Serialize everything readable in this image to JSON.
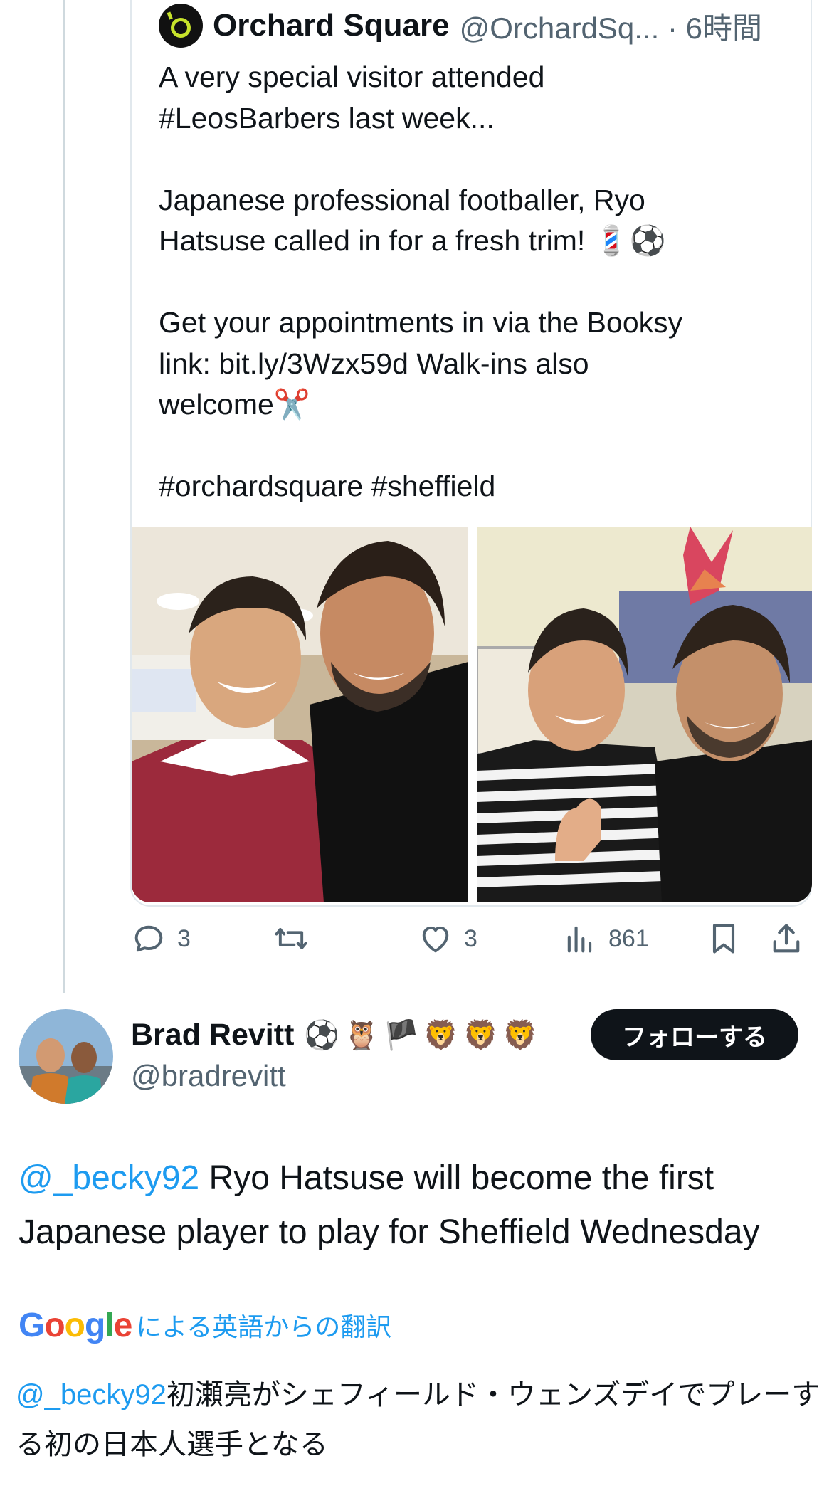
{
  "quote": {
    "name": "Orchard Square",
    "handle_time": "@OrchardSq... · 6時間",
    "text": "A very special visitor attended\n#LeosBarbers last week...\n\nJapanese professional footballer, Ryo\nHatsuse called in for a fresh trim! 💈⚽\n\nGet your appointments in via the Booksy\nlink: bit.ly/3Wzx59d Walk-ins also\nwelcome✂️\n\n#orchardsquare #sheffield"
  },
  "actions": {
    "reply_count": "3",
    "like_count": "3",
    "view_count": "861"
  },
  "reply": {
    "name": "Brad Revitt",
    "emojis": "⚽🦉🏴🦁🦁🦁",
    "handle": "@bradrevitt",
    "follow_label": "フォローする",
    "mention": "@_becky92",
    "text": " Ryo Hatsuse will become the first Japanese player to play for Sheffield Wednesday",
    "translation_label": "による英語からの翻訳",
    "translated_mention": "@_becky92",
    "translated_text": "初瀬亮がシェフィールド・ウェンズデイでプレーする初の日本人選手となる"
  },
  "google_logo": {
    "text": "Google",
    "colors": [
      "#4285f4",
      "#ea4335",
      "#fbbc05",
      "#4285f4",
      "#34a853",
      "#ea4335"
    ]
  },
  "colors": {
    "accent": "#1d9bf0",
    "muted": "#536471",
    "text": "#0f1419"
  }
}
